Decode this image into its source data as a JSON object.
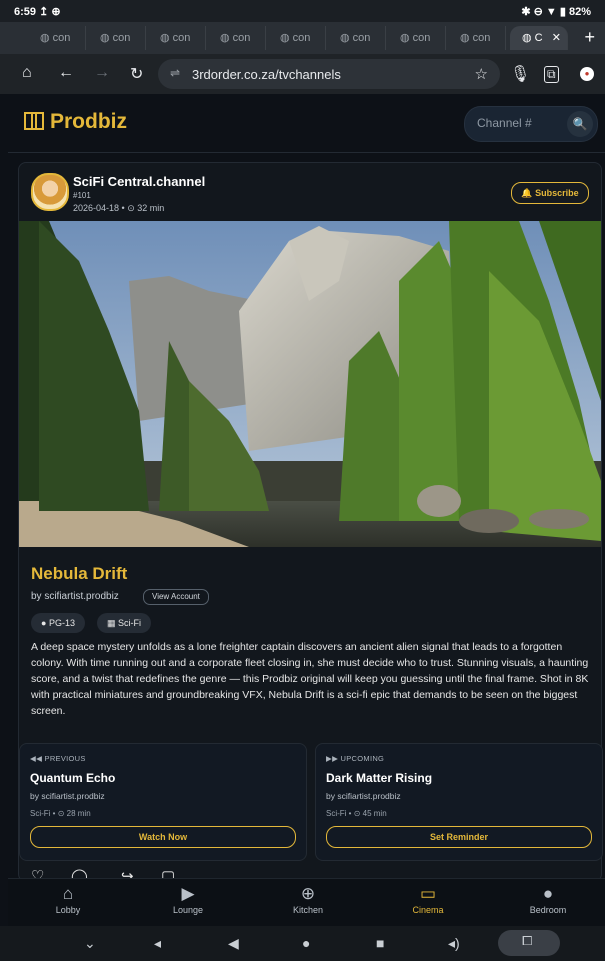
{
  "status_bar": {
    "time": "6:59",
    "battery": "82%",
    "left_icons": "↥ ⊕",
    "right_icons": "✱ ⊖ ▼ ▮"
  },
  "browser": {
    "tabs": [
      "con",
      "con",
      "con",
      "con",
      "con",
      "con",
      "con",
      "con",
      "C"
    ],
    "url": "3rdorder.co.za/tvchannels",
    "new_tab": "+",
    "nav": {
      "home": "⌂",
      "back": "←",
      "forward": "→",
      "reload": "↻"
    }
  },
  "site": {
    "brand": "Prodbiz",
    "channel_placeholder": "Channel #",
    "search_icon": "search-icon"
  },
  "channel": {
    "name": "SciFi Central.channel",
    "number": "#101",
    "date": "2026-04-18",
    "duration": "32 min",
    "subscribe_label": "Subscribe"
  },
  "content": {
    "title": "Nebula Drift",
    "byline": "by scifiartist.prodbiz",
    "view_account": "View Account",
    "rating": "PG-13",
    "genre": "Sci-Fi",
    "description": "A deep space mystery unfolds as a lone freighter captain discovers an ancient alien signal that leads to a forgotten colony. With time running out and a corporate fleet closing in, she must decide who to trust. Stunning visuals, a haunting score, and a twist that redefines the genre — this Prodbiz original will keep you guessing until the final frame. Shot in 8K with practical miniatures and groundbreaking VFX, Nebula Drift is a sci-fi epic that demands to be seen on the biggest screen."
  },
  "previous": {
    "label": "PREVIOUS",
    "title": "Quantum Echo",
    "byline": "by scifiartist.prodbiz",
    "genre": "Sci-Fi",
    "duration": "28 min",
    "button": "Watch Now"
  },
  "upcoming": {
    "label": "UPCOMING",
    "title": "Dark Matter Rising",
    "byline": "by scifiartist.prodbiz",
    "genre": "Sci-Fi",
    "duration": "45 min",
    "button": "Set Reminder"
  },
  "bottom_nav": [
    {
      "label": "Lobby",
      "icon": "home-icon"
    },
    {
      "label": "Lounge",
      "icon": "play-icon"
    },
    {
      "label": "Kitchen",
      "icon": "plus-circle-icon"
    },
    {
      "label": "Cinema",
      "icon": "tv-icon",
      "active": true
    },
    {
      "label": "Bedroom",
      "icon": "person-icon"
    }
  ],
  "colors": {
    "accent": "#e4b83a",
    "background": "#0d1117",
    "card": "#12171d"
  }
}
